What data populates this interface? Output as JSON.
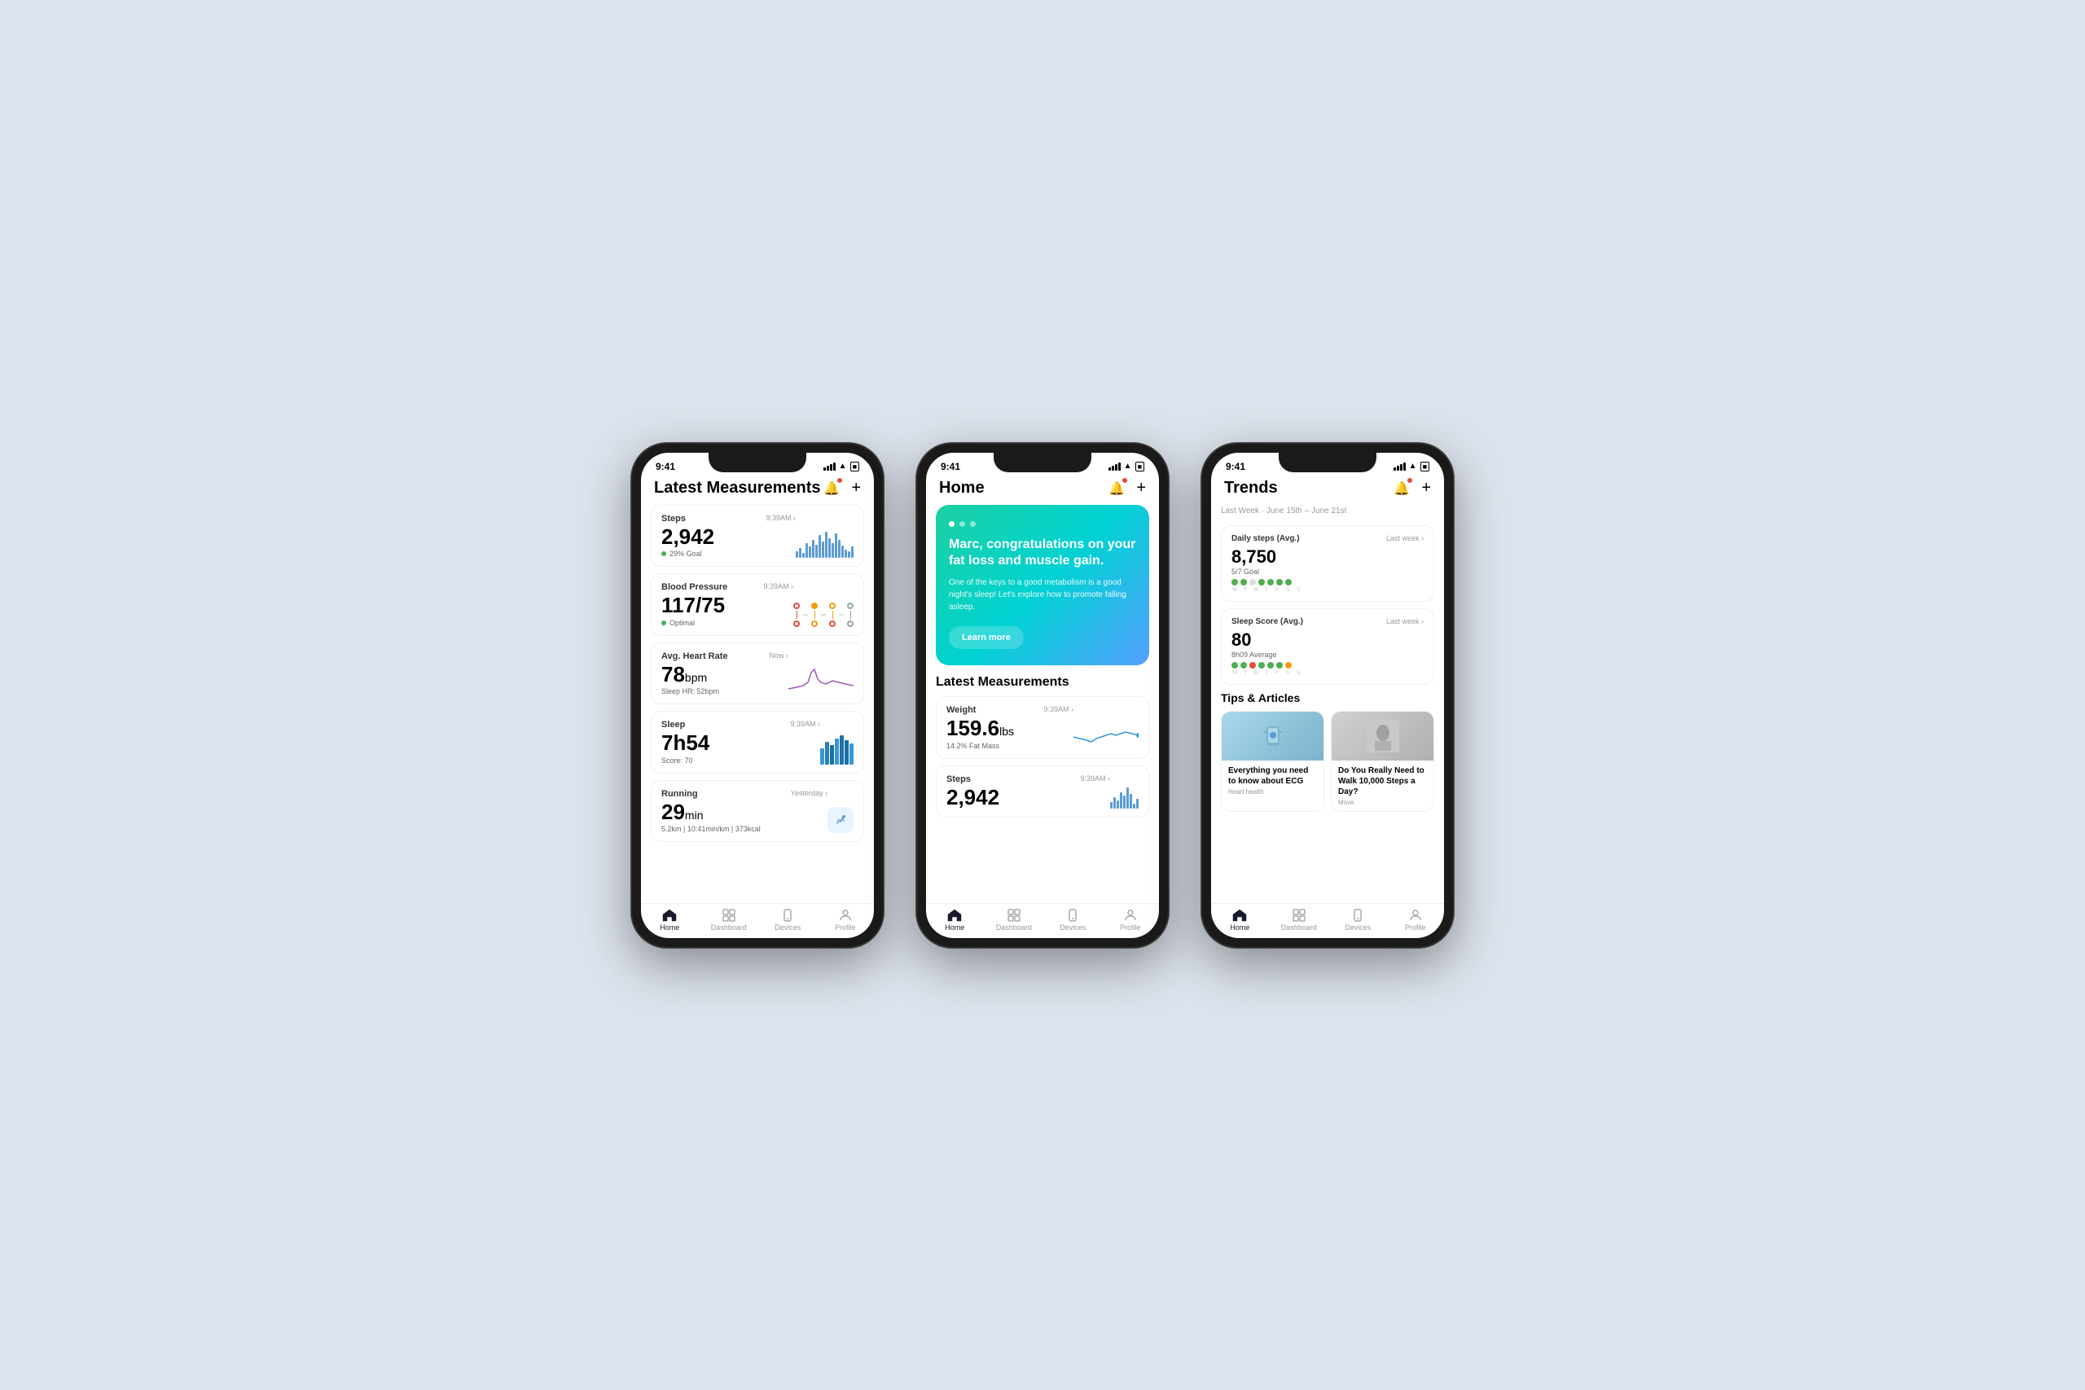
{
  "bg_color": "#dde3ec",
  "phones": [
    {
      "id": "phone-left",
      "status_time": "9:41",
      "screen_title": "Latest Measurements",
      "cards": [
        {
          "id": "steps",
          "title": "Steps",
          "time": "9:39AM",
          "value": "2,942",
          "unit": "",
          "sub": "29% Goal",
          "sub_type": "goal",
          "chart_type": "bars"
        },
        {
          "id": "blood-pressure",
          "title": "Blood Pressure",
          "time": "9:39AM",
          "value": "117/75",
          "unit": "",
          "sub": "Optimal",
          "sub_type": "optimal",
          "chart_type": "bp"
        },
        {
          "id": "heart-rate",
          "title": "Avg. Heart Rate",
          "time": "Now",
          "value": "78",
          "unit": "bpm",
          "sub": "Sleep HR: 52bpm",
          "sub_type": "plain",
          "chart_type": "sparkline"
        },
        {
          "id": "sleep",
          "title": "Sleep",
          "time": "9:39AM",
          "value": "7h54",
          "unit": "",
          "sub": "Score: 70",
          "sub_type": "plain",
          "chart_type": "sleep-bars"
        },
        {
          "id": "running",
          "title": "Running",
          "time": "Yesterday",
          "value": "29",
          "unit": "min",
          "sub": "5.2km | 10:41min/km | 373kcal",
          "sub_type": "plain",
          "chart_type": "run-icon"
        }
      ],
      "nav": [
        "Home",
        "Dashboard",
        "Devices",
        "Profile"
      ],
      "nav_active": 0
    },
    {
      "id": "phone-middle",
      "status_time": "9:41",
      "screen_title": "Home",
      "promo": {
        "dots": [
          true,
          false,
          false
        ],
        "title": "Marc, congratulations on your fat loss and muscle gain.",
        "desc": "One of the keys to a good metabolism is a good night's sleep! Let's explore how to promote falling asleep.",
        "button": "Learn more"
      },
      "latest_title": "Latest Measurements",
      "cards": [
        {
          "id": "weight",
          "title": "Weight",
          "time": "9:39AM",
          "value": "159.6",
          "unit": "lbs",
          "sub": "14.2% Fat Mass",
          "chart_type": "weight-sparkline"
        },
        {
          "id": "steps2",
          "title": "Steps",
          "time": "9:39AM",
          "value": "2,942",
          "unit": "",
          "sub": "",
          "chart_type": "bars"
        }
      ],
      "nav": [
        "Home",
        "Dashboard",
        "Devices",
        "Profile"
      ],
      "nav_active": 0
    },
    {
      "id": "phone-right",
      "status_time": "9:41",
      "screen_title": "Trends",
      "subtitle": "Last Week · June 15th – June 21st",
      "trend_cards": [
        {
          "id": "daily-steps",
          "title": "Daily steps (Avg.)",
          "link": "Last week",
          "value": "8,750",
          "sub": "5/7 Goal",
          "dots": [
            "green",
            "green",
            "gray",
            "green",
            "green",
            "green",
            "green"
          ],
          "days": [
            "M",
            "T",
            "W",
            "T",
            "F",
            "S",
            "S"
          ]
        },
        {
          "id": "sleep-score",
          "title": "Sleep Score (Avg.)",
          "link": "Last week",
          "value": "80",
          "sub": "8h09 Average",
          "dots": [
            "green",
            "green",
            "red",
            "green",
            "green",
            "green",
            "yellow"
          ],
          "days": [
            "M",
            "T",
            "W",
            "T",
            "F",
            "S",
            "S"
          ]
        }
      ],
      "tips_title": "Tips & Articles",
      "tips": [
        {
          "id": "ecg-article",
          "title": "Everything you need to know about ECG",
          "category": "Heart health",
          "img_type": "arm"
        },
        {
          "id": "steps-article",
          "title": "Do You Really Need to Walk 10,000 Steps a Day?",
          "category": "Move",
          "img_type": "steps"
        }
      ],
      "nav": [
        "Home",
        "Dashboard",
        "Devices",
        "Profile"
      ],
      "nav_active": 0
    }
  ],
  "icons": {
    "bell": "🔔",
    "plus": "+",
    "home": "⌂",
    "dashboard": "▦",
    "devices": "⌚",
    "profile": "👤",
    "chevron": "›",
    "run": "🏃"
  },
  "dot_colors": {
    "green": "#4caf50",
    "gray": "#ddd",
    "red": "#e74c3c",
    "yellow": "#f39c12"
  }
}
